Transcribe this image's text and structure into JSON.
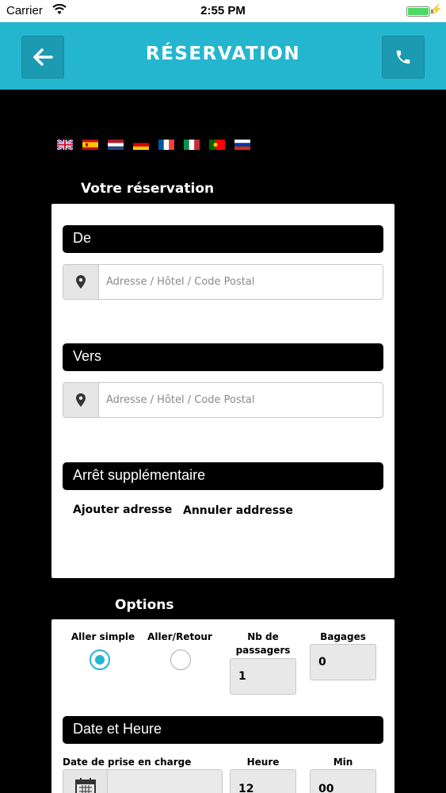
{
  "status_bar": {
    "carrier": "Carrier",
    "time": "2:55 PM",
    "battery_level": 1.0
  },
  "header": {
    "title": "RÉSERVATION",
    "back_icon": "arrow-left-icon",
    "call_icon": "phone-icon",
    "color": "#25b6cf"
  },
  "languages": [
    {
      "code": "en",
      "icon": "flag-uk-icon"
    },
    {
      "code": "es",
      "icon": "flag-spain-icon"
    },
    {
      "code": "nl",
      "icon": "flag-netherlands-icon"
    },
    {
      "code": "de",
      "icon": "flag-germany-icon"
    },
    {
      "code": "fr",
      "icon": "flag-france-icon"
    },
    {
      "code": "it",
      "icon": "flag-italy-icon"
    },
    {
      "code": "pt",
      "icon": "flag-portugal-icon"
    },
    {
      "code": "ru",
      "icon": "flag-russia-icon"
    }
  ],
  "reservation": {
    "section_title": "Votre réservation",
    "from": {
      "label": "De",
      "placeholder": "Adresse / Hôtel / Code Postal",
      "value": ""
    },
    "to": {
      "label": "Vers",
      "placeholder": "Adresse / Hôtel / Code Postal",
      "value": ""
    },
    "extra_stop": {
      "label": "Arrêt supplémentaire",
      "add_label": "Ajouter adresse",
      "cancel_label": "Annuler addresse"
    }
  },
  "options": {
    "section_title": "Options",
    "one_way_label": "Aller simple",
    "one_way_selected": true,
    "round_trip_label": "Aller/Retour",
    "round_trip_selected": false,
    "passengers_label": "Nb de passagers",
    "passengers_value": "1",
    "luggage_label": "Bagages",
    "luggage_value": "0"
  },
  "datetime": {
    "label": "Date et Heure",
    "pickup_date_label": "Date de prise en charge",
    "pickup_date_value": "",
    "hour_label": "Heure",
    "hour_value": "12",
    "min_label": "Min",
    "min_value": "00"
  }
}
